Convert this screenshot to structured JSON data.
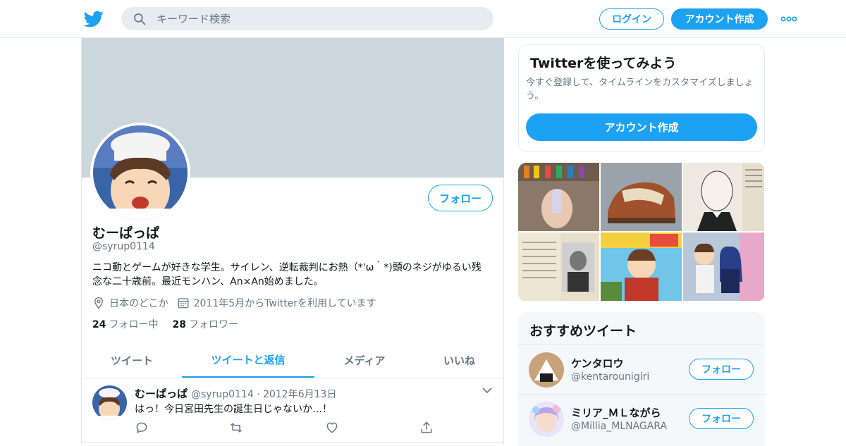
{
  "header": {
    "search_placeholder": "キーワード検索",
    "login_label": "ログイン",
    "signup_label": "アカウント作成",
    "brand_color": "#1da1f2"
  },
  "profile": {
    "display_name": "むーぱっぱ",
    "handle": "@syrup0114",
    "follow_label": "フォロー",
    "bio": "ニコ動とゲームが好きな学生。サイレン、逆転裁判にお熱（*'ω｀*)頭のネジがゆるい残念な二十歳前。最近モンハン、An×An始めました。",
    "location": "日本のどこか",
    "joined": "2011年5月からTwitterを利用しています",
    "following_count": "24",
    "following_label": "フォロー中",
    "followers_count": "28",
    "followers_label": "フォロワー"
  },
  "tabs": [
    {
      "label": "ツイート",
      "active": false
    },
    {
      "label": "ツイートと返信",
      "active": true
    },
    {
      "label": "メディア",
      "active": false
    },
    {
      "label": "いいね",
      "active": false
    }
  ],
  "tweet": {
    "name": "むーぱっぱ",
    "meta": "@syrup0114 · 2012年6月13日",
    "text": "はっ！今日宮田先生の誕生日じゃないか…！"
  },
  "signup_card": {
    "title": "Twitterを使ってみよう",
    "description": "今すぐ登録して、タイムラインをカスタマイズしましょう。",
    "button_label": "アカウント作成"
  },
  "recommend": {
    "title": "おすすめツイート",
    "follow_label": "フォロー",
    "users": [
      {
        "name": "ケンタロウ",
        "handle": "@kentarounigiri"
      },
      {
        "name": "ミリア_ＭＬながら",
        "handle": "@Millia_MLNAGARA"
      }
    ]
  }
}
